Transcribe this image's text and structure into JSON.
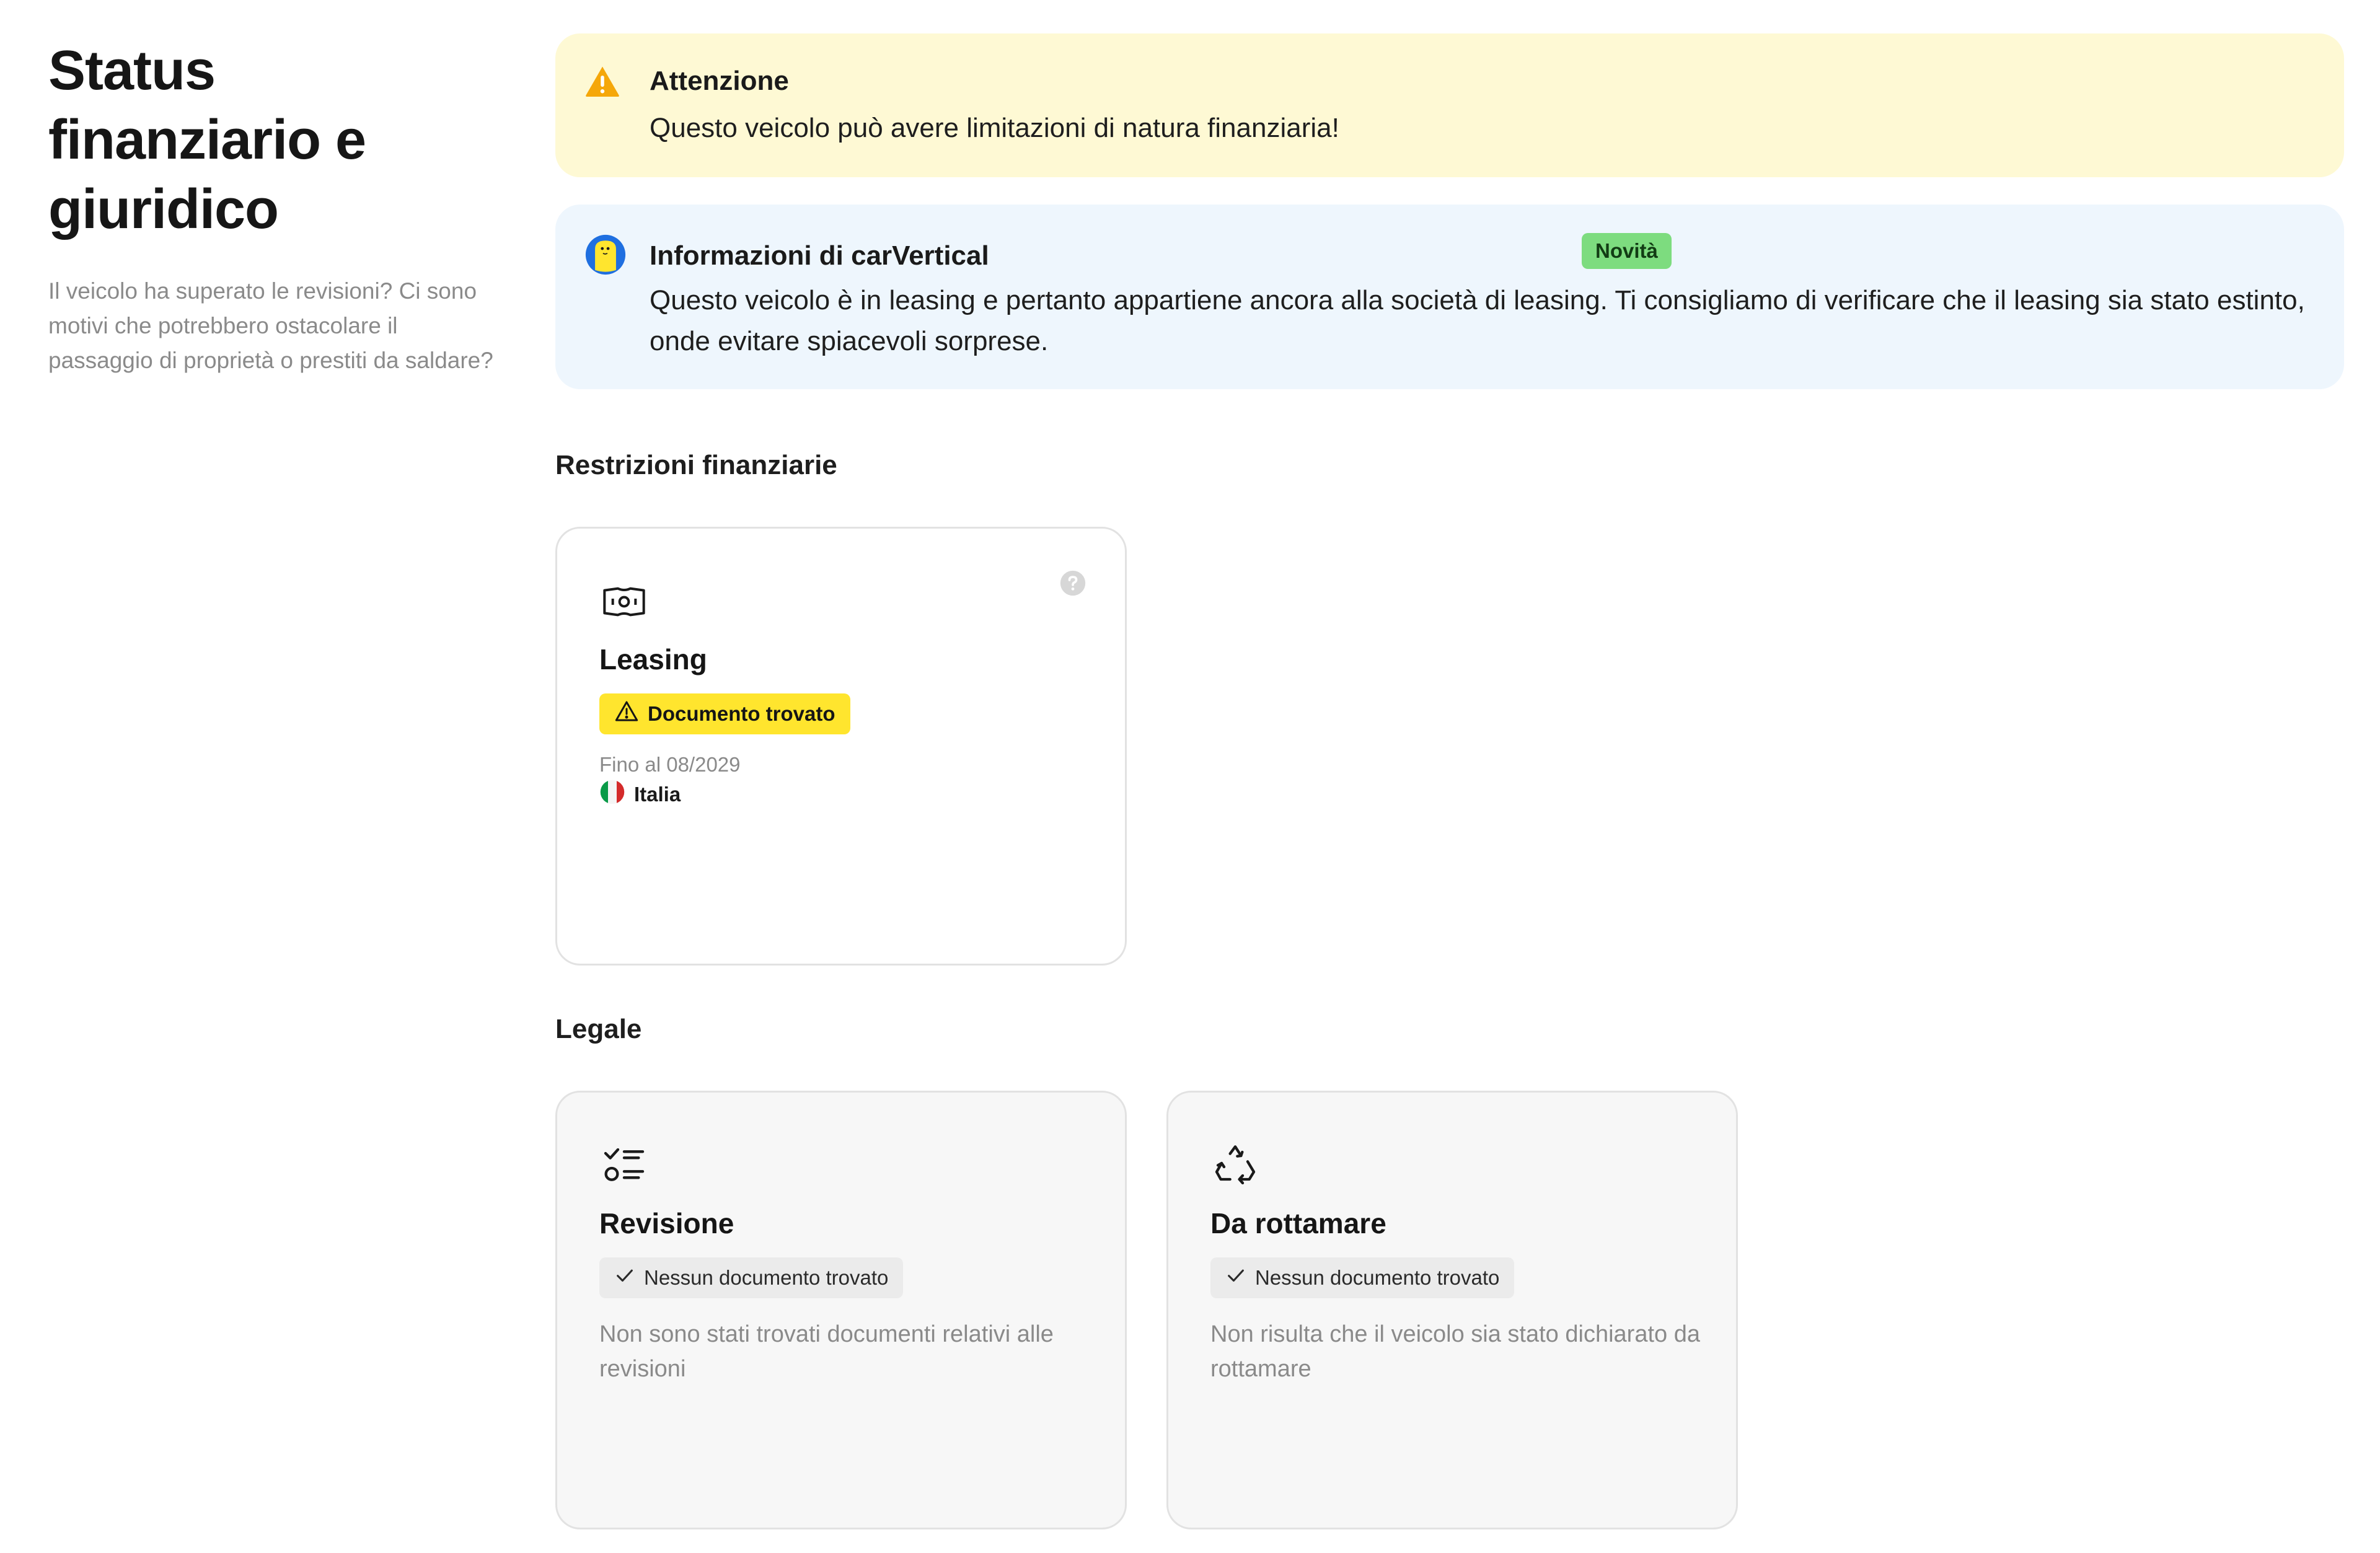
{
  "header": {
    "title": "Status finanziario e giuridico",
    "description": "Il veicolo ha superato le revisioni? Ci sono motivi che potrebbero ostacolare il passaggio di proprietà o prestiti da saldare?"
  },
  "alerts": {
    "warning": {
      "icon": "warning-icon",
      "title": "Attenzione",
      "text": "Questo veicolo può avere limitazioni di natura finanziaria!",
      "color": "#fef9d4"
    },
    "info": {
      "icon": "carvertical-mascot-icon",
      "title": "Informazioni di carVertical",
      "badge": "Novità",
      "text": "Questo veicolo è in leasing e pertanto appartiene ancora alla società di leasing. Ti consigliamo di verificare che il leasing sia stato estinto, onde evitare spiacevoli sorprese.",
      "color": "#eef6fd"
    }
  },
  "sections": {
    "financial": {
      "title": "Restrizioni finanziarie",
      "cards": [
        {
          "icon": "banknote-icon",
          "title": "Leasing",
          "status": "Documento trovato",
          "status_color": "#ffe52e",
          "until": "Fino al 08/2029",
          "country": "Italia",
          "country_icon": "italy-flag-icon"
        }
      ]
    },
    "legal": {
      "title": "Legale",
      "cards": [
        {
          "icon": "checklist-icon",
          "title": "Revisione",
          "status": "Nessun documento trovato",
          "description": "Non sono stati trovati documenti relativi alle revisioni"
        },
        {
          "icon": "recycle-icon",
          "title": "Da rottamare",
          "status": "Nessun documento trovato",
          "description": "Non risulta che il veicolo sia stato dichiarato da rottamare"
        }
      ]
    }
  }
}
